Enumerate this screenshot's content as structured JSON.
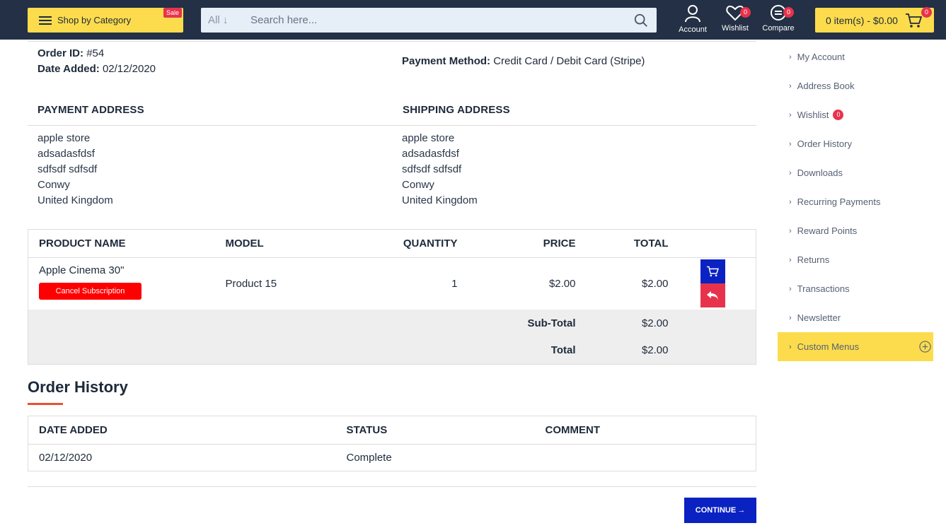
{
  "header": {
    "category_label": "Shop by Category",
    "sale_tag": "Sale",
    "search_scope": "All",
    "search_placeholder": "Search here...",
    "account_label": "Account",
    "wishlist_label": "Wishlist",
    "wishlist_count": "0",
    "compare_label": "Compare",
    "compare_count": "0",
    "cart_label": "0 item(s) - $0.00",
    "cart_count": "0",
    "accent_color": "#fcdc4d",
    "bg_color": "#233045"
  },
  "order": {
    "id_label": "Order ID:",
    "id_value": "#54",
    "date_label": "Date Added:",
    "date_value": "02/12/2020",
    "payment_label": "Payment Method:",
    "payment_value": "Credit Card / Debit Card (Stripe)"
  },
  "payment_address": {
    "heading": "PAYMENT ADDRESS",
    "lines": [
      "apple store",
      "adsadasfdsf",
      "sdfsdf sdfsdf",
      "Conwy",
      "United Kingdom"
    ]
  },
  "shipping_address": {
    "heading": "SHIPPING ADDRESS",
    "lines": [
      "apple store",
      "adsadasfdsf",
      "sdfsdf sdfsdf",
      "Conwy",
      "United Kingdom"
    ]
  },
  "products": {
    "headers": [
      "PRODUCT NAME",
      "MODEL",
      "QUANTITY",
      "PRICE",
      "TOTAL"
    ],
    "rows": [
      {
        "name": "Apple Cinema 30\"",
        "cancel_label": "Cancel Subscription",
        "model": "Product 15",
        "quantity": "1",
        "price": "$2.00",
        "total": "$2.00"
      }
    ],
    "subtotal_label": "Sub-Total",
    "subtotal_value": "$2.00",
    "total_label": "Total",
    "total_value": "$2.00"
  },
  "history": {
    "title": "Order History",
    "headers": [
      "DATE ADDED",
      "STATUS",
      "COMMENT"
    ],
    "rows": [
      {
        "date": "02/12/2020",
        "status": "Complete",
        "comment": ""
      }
    ]
  },
  "continue_label": "CONTINUE",
  "sidebar": {
    "items": [
      {
        "label": "My Account"
      },
      {
        "label": "Address Book"
      },
      {
        "label": "Wishlist",
        "badge": "0"
      },
      {
        "label": "Order History"
      },
      {
        "label": "Downloads"
      },
      {
        "label": "Recurring Payments"
      },
      {
        "label": "Reward Points"
      },
      {
        "label": "Returns"
      },
      {
        "label": "Transactions"
      },
      {
        "label": "Newsletter"
      },
      {
        "label": "Custom Menus"
      }
    ]
  }
}
